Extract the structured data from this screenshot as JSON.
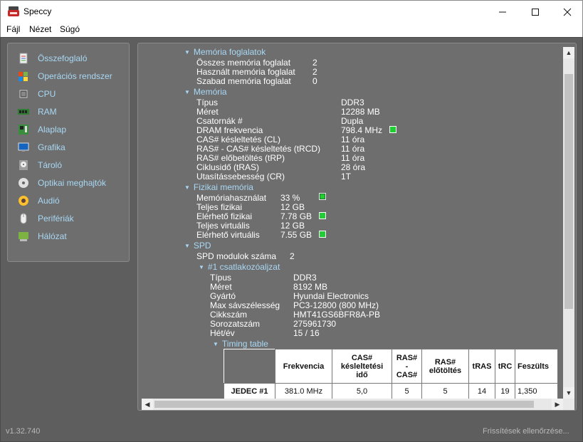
{
  "window": {
    "title": "Speccy"
  },
  "menu": [
    "Fájl",
    "Nézet",
    "Súgó"
  ],
  "sidebar": {
    "items": [
      {
        "label": "Összefoglaló",
        "icon": "summary-icon"
      },
      {
        "label": "Operációs rendszer",
        "icon": "windows-icon"
      },
      {
        "label": "CPU",
        "icon": "cpu-icon"
      },
      {
        "label": "RAM",
        "icon": "ram-icon"
      },
      {
        "label": "Alaplap",
        "icon": "motherboard-icon"
      },
      {
        "label": "Grafika",
        "icon": "monitor-icon"
      },
      {
        "label": "Tároló",
        "icon": "hdd-icon"
      },
      {
        "label": "Optikai meghajtók",
        "icon": "disc-icon"
      },
      {
        "label": "Audió",
        "icon": "speaker-icon"
      },
      {
        "label": "Perifériák",
        "icon": "mouse-icon"
      },
      {
        "label": "Hálózat",
        "icon": "network-icon"
      }
    ]
  },
  "sections": {
    "memory_slots": {
      "title": "Memória foglalatok",
      "rows": [
        {
          "label": "Összes memória foglalat",
          "value": "2"
        },
        {
          "label": "Használt memória foglalat",
          "value": "2"
        },
        {
          "label": "Szabad memória foglalat",
          "value": "0"
        }
      ]
    },
    "memory": {
      "title": "Memória",
      "rows": [
        {
          "label": "Típus",
          "value": "DDR3"
        },
        {
          "label": "Méret",
          "value": "12288 MB"
        },
        {
          "label": "Csatornák #",
          "value": "Dupla"
        },
        {
          "label": "DRAM frekvencia",
          "value": "798.4 MHz"
        },
        {
          "label": "CAS# késleltetés (CL)",
          "value": "11 óra"
        },
        {
          "label": "RAS# - CAS# késleltetés (tRCD)",
          "value": "11 óra"
        },
        {
          "label": "RAS# előbetöltés (tRP)",
          "value": "11 óra"
        },
        {
          "label": "Ciklusidő (tRAS)",
          "value": "28 óra"
        },
        {
          "label": "Utasítássebesség (CR)",
          "value": "1T"
        }
      ]
    },
    "physical": {
      "title": "Fizikai memória",
      "rows": [
        {
          "label": "Memóriahasználat",
          "value": "33 %"
        },
        {
          "label": "Teljes fizikai",
          "value": "12 GB"
        },
        {
          "label": "Elérhető fizikai",
          "value": "7.78 GB"
        },
        {
          "label": "Teljes virtuális",
          "value": "12 GB"
        },
        {
          "label": "Elérhető virtuális",
          "value": "7.55 GB"
        }
      ]
    },
    "spd": {
      "title": "SPD",
      "module_count_label": "SPD modulok száma",
      "module_count_value": "2",
      "slot_title": "#1 csatlakozóaljzat",
      "rows": [
        {
          "label": "Típus",
          "value": "DDR3"
        },
        {
          "label": "Méret",
          "value": "8192 MB"
        },
        {
          "label": "Gyártó",
          "value": "Hyundai Electronics"
        },
        {
          "label": "Max sávszélesség",
          "value": "PC3-12800 (800 MHz)"
        },
        {
          "label": "Cikkszám",
          "value": "HMT41GS6BFR8A-PB"
        },
        {
          "label": "Sorozatszám",
          "value": "275961730"
        },
        {
          "label": "Hét/év",
          "value": "15 / 16"
        }
      ],
      "timing_title": "Timing table",
      "timing_headers": [
        "",
        "Frekvencia",
        "CAS# késleltetési idő",
        "RAS# - CAS#",
        "RAS# előtöltés",
        "tRAS",
        "tRC",
        "Feszülts"
      ],
      "timing_row": [
        "JEDEC #1",
        "381.0 MHz",
        "5,0",
        "5",
        "5",
        "14",
        "19",
        "1,350"
      ]
    }
  },
  "status": {
    "version": "v1.32.740",
    "updates": "Frissítések ellenőrzése..."
  }
}
